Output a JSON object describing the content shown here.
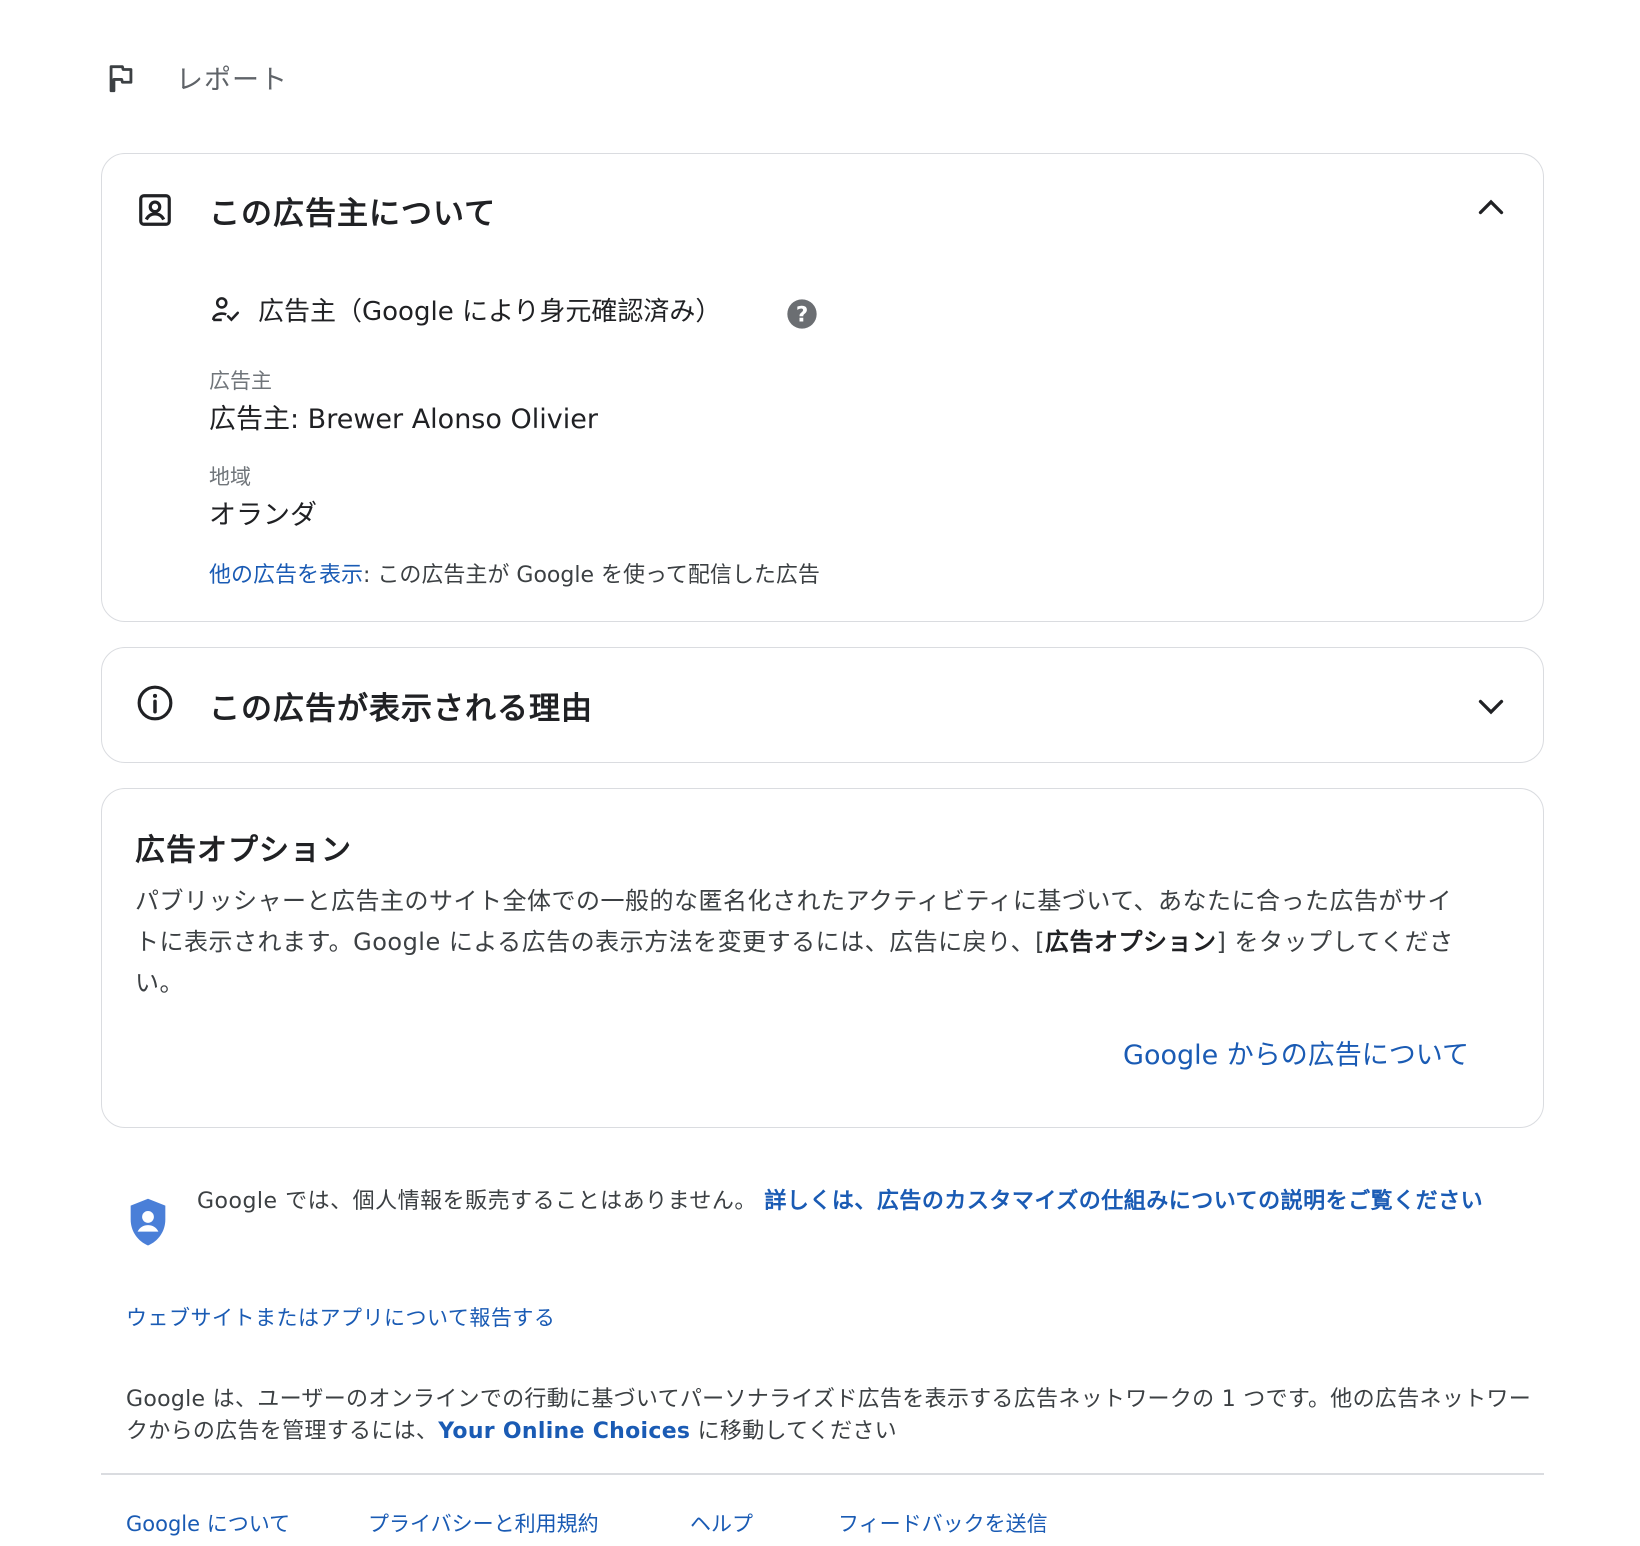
{
  "report": {
    "label": "レポート",
    "icon": "flag-icon"
  },
  "advertiser_card": {
    "title": "この広告主について",
    "icon": "account-box-icon",
    "toggle_icon": "chevron-up-icon",
    "verified_label": "広告主（Google により身元確認済み）",
    "verified_icon": "person-check-icon",
    "help_icon": "help-circle-icon",
    "advertiser_label": "広告主",
    "advertiser_value": "広告主: Brewer Alonso Olivier",
    "region_label": "地域",
    "region_value": "オランダ",
    "more_ads_link": "他の広告を表示",
    "more_ads_text": ": この広告主が Google を使って配信した広告"
  },
  "reason_card": {
    "title": "この広告が表示される理由",
    "icon": "info-icon",
    "toggle_icon": "chevron-down-icon"
  },
  "options_card": {
    "title": "広告オプション",
    "body_part1": "パブリッシャーと広告主のサイト全体での一般的な匿名化されたアクティビティに基づいて、あなたに合った広告がサイトに表示されます。Google による広告の表示方法を変更するには、広告に戻り、[",
    "body_bold": "広告オプション",
    "body_part2": "] をタップしてください。",
    "link": "Google からの広告について"
  },
  "privacy": {
    "icon": "shield-person-icon",
    "text": "Google では、個人情報を販売することはありません。",
    "link": "詳しくは、広告のカスタマイズの仕組みについての説明をご覧ください"
  },
  "report_site_link": "ウェブサイトまたはアプリについて報告する",
  "network": {
    "text_part1": "Google は、ユーザーのオンラインでの行動に基づいてパーソナライズド広告を表示する広告ネットワークの 1 つです。他の広告ネットワークからの広告を管理するには、",
    "link": "Your Online Choices",
    "text_part2": " に移動してください"
  },
  "footer": {
    "links": [
      "Google について",
      "プライバシーと利用規約",
      "ヘルプ",
      "フィードバックを送信"
    ]
  },
  "colors": {
    "link": "#1a5bb4",
    "border": "#dadce0",
    "text": "#202124",
    "muted": "#70757a",
    "shield": "#4a7fd8"
  }
}
